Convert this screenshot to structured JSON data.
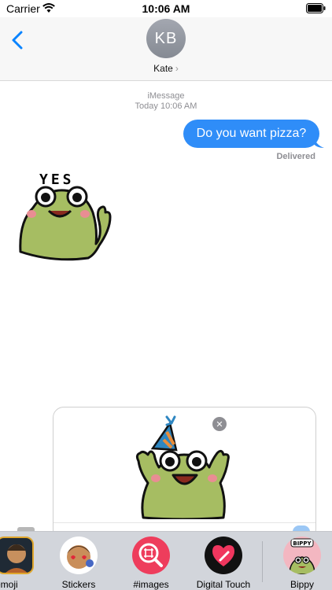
{
  "status": {
    "carrier": "Carrier",
    "time": "10:06 AM"
  },
  "contact": {
    "initials": "KB",
    "name": "Kate"
  },
  "thread": {
    "service": "iMessage",
    "timestamp": "Today 10:06 AM",
    "message": "Do you want pizza?",
    "receipt": "Delivered",
    "sticker_text": "YES"
  },
  "drawer": {
    "sticker_name": "party-frog",
    "remove_symbol": "✕"
  },
  "apps": [
    {
      "label": "emoji",
      "icon": "memoji-icon"
    },
    {
      "label": "Stickers",
      "icon": "stickers-icon"
    },
    {
      "label": "#images",
      "icon": "images-search-icon"
    },
    {
      "label": "Digital Touch",
      "icon": "digital-touch-icon"
    },
    {
      "label": "Bippy",
      "icon": "bippy-icon",
      "icon_text": "BIPPY"
    }
  ],
  "colors": {
    "bubble": "#2f8df8",
    "accent": "#0a84ff",
    "frog": "#a6bd62",
    "images": "#ee3d5c"
  }
}
